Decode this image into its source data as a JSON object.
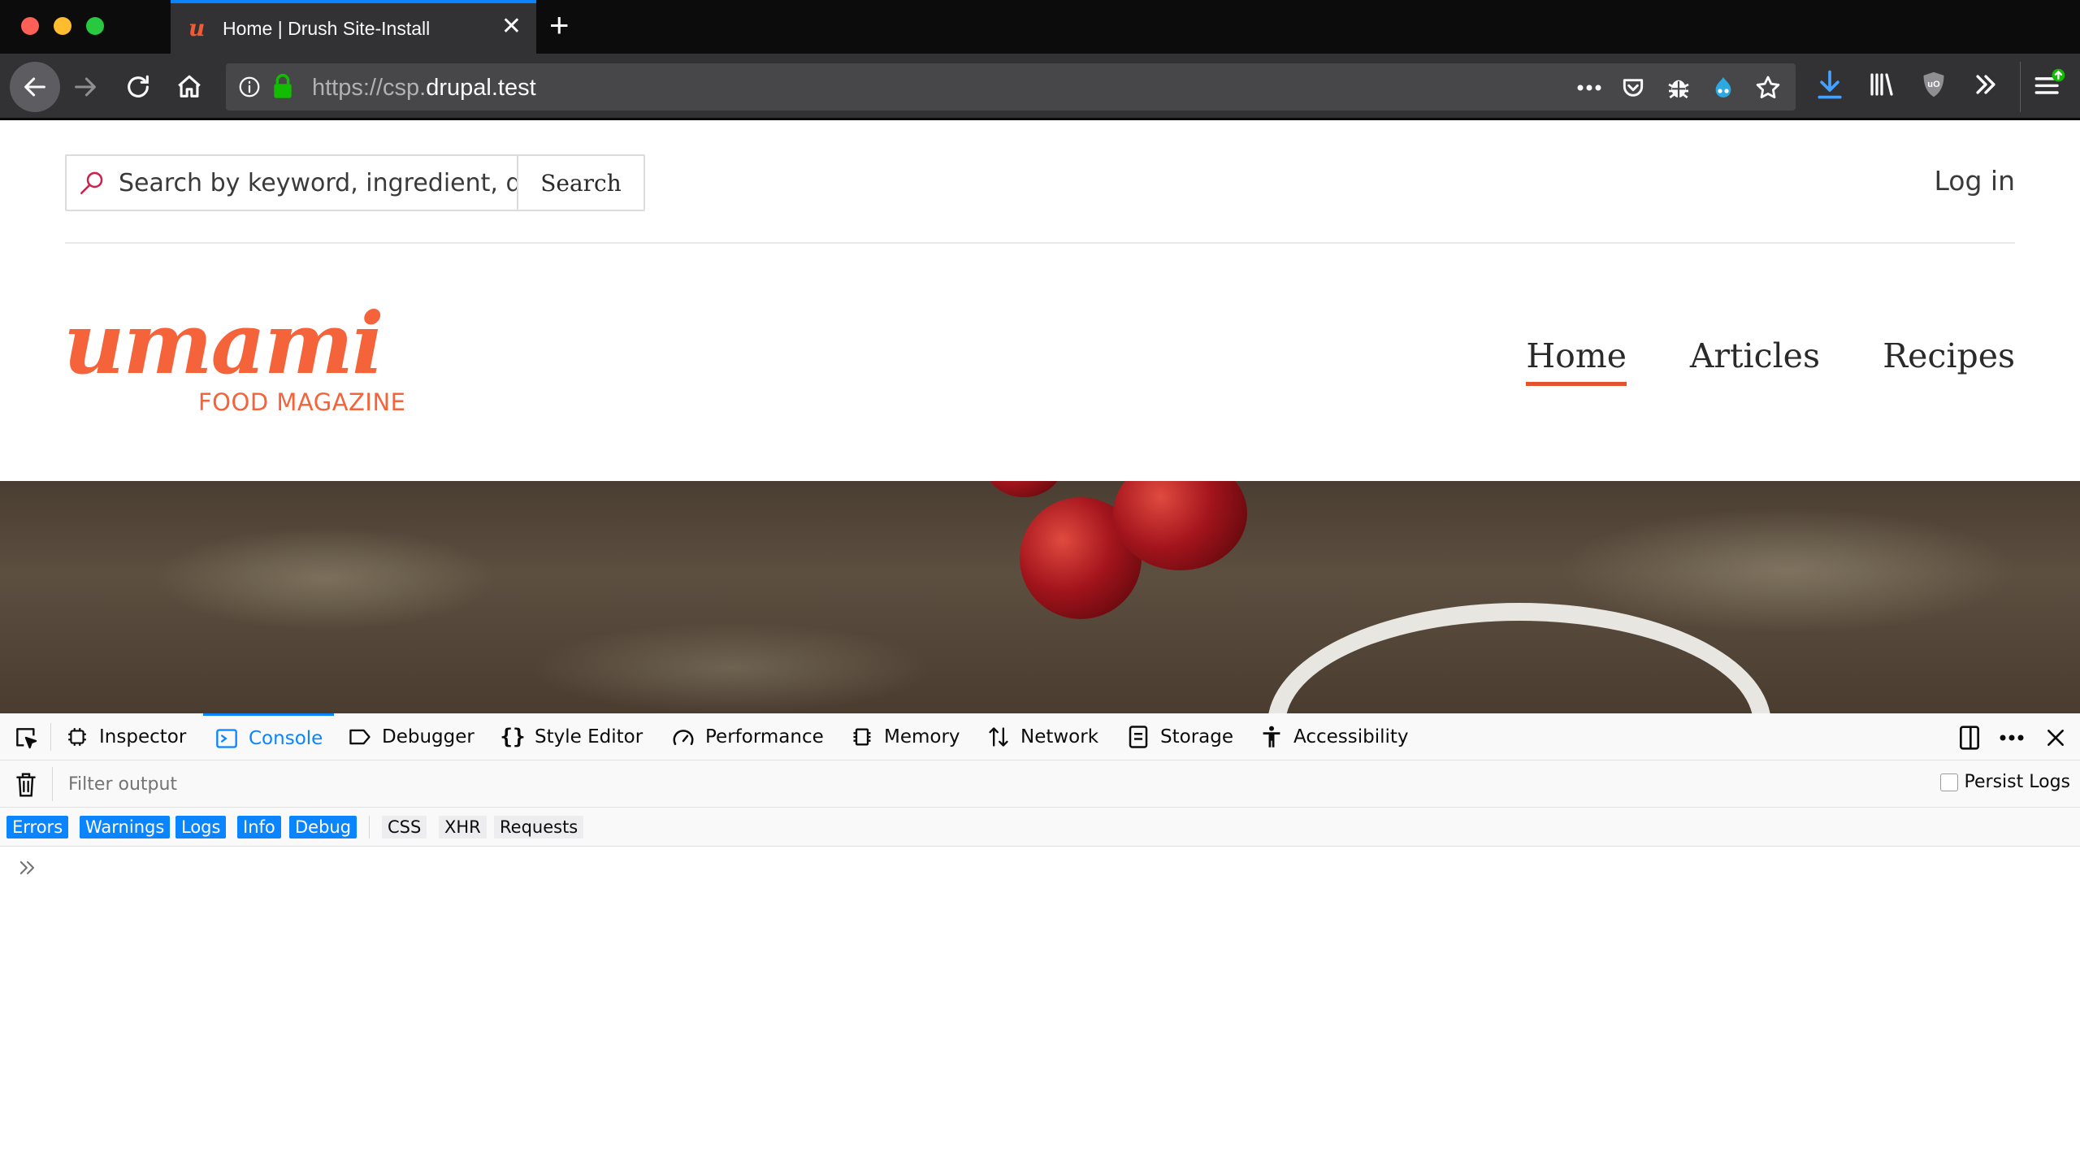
{
  "browser": {
    "tab_title": "Home | Drush Site-Install",
    "url_scheme": "https://csp.",
    "url_host": "drupal.test"
  },
  "page": {
    "search": {
      "placeholder": "Search by keyword, ingredient, dish",
      "button_label": "Search"
    },
    "login_label": "Log in",
    "logo": {
      "wordmark": "umami",
      "tagline": "FOOD MAGAZINE"
    },
    "nav": [
      {
        "label": "Home",
        "active": true
      },
      {
        "label": "Articles"
      },
      {
        "label": "Recipes"
      }
    ]
  },
  "devtools": {
    "tabs": [
      {
        "label": "Inspector",
        "icon": "inspector-icon"
      },
      {
        "label": "Console",
        "icon": "console-icon",
        "selected": true
      },
      {
        "label": "Debugger",
        "icon": "debugger-icon"
      },
      {
        "label": "Style Editor",
        "icon": "style-editor-icon"
      },
      {
        "label": "Performance",
        "icon": "performance-icon"
      },
      {
        "label": "Memory",
        "icon": "memory-icon"
      },
      {
        "label": "Network",
        "icon": "network-icon"
      },
      {
        "label": "Storage",
        "icon": "storage-icon"
      },
      {
        "label": "Accessibility",
        "icon": "accessibility-icon"
      }
    ],
    "filter_placeholder": "Filter output",
    "persist_logs_label": "Persist Logs",
    "levels": [
      {
        "label": "Errors",
        "on": true
      },
      {
        "label": "Warnings",
        "on": true
      },
      {
        "label": "Logs",
        "on": true
      },
      {
        "label": "Info",
        "on": true
      },
      {
        "label": "Debug",
        "on": true
      }
    ],
    "categories": [
      {
        "label": "CSS"
      },
      {
        "label": "XHR"
      },
      {
        "label": "Requests"
      }
    ]
  },
  "colors": {
    "brand": "#f4633a",
    "devtools_accent": "#0a84ff"
  }
}
